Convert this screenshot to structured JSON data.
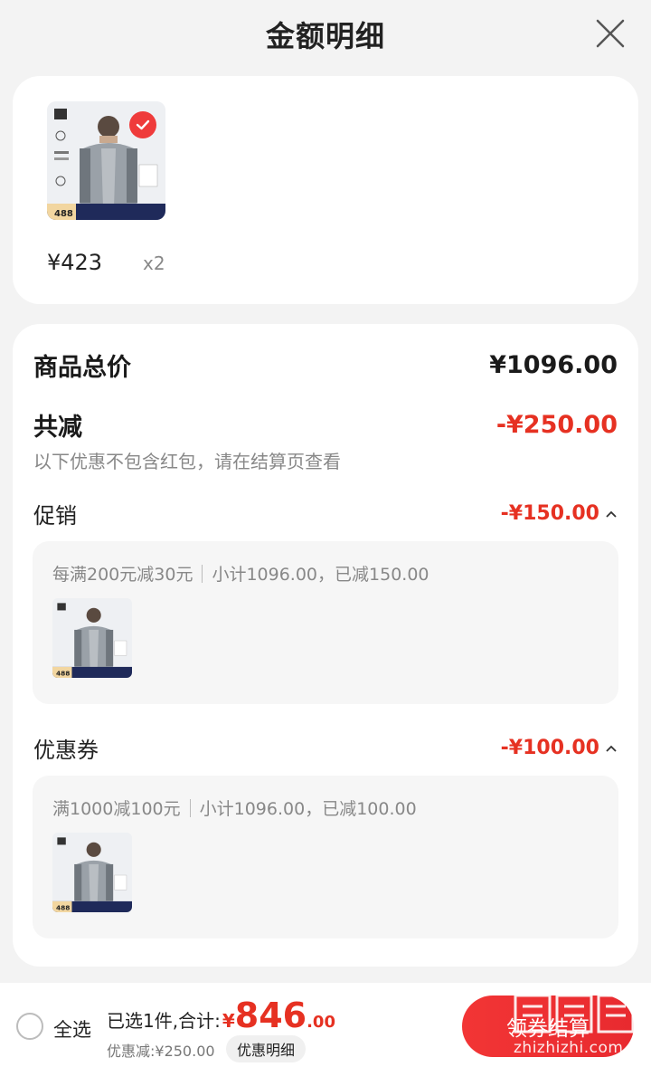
{
  "header": {
    "title": "金额明细"
  },
  "product": {
    "price": "¥423",
    "qty": "x2",
    "thumb_price": "488"
  },
  "summary": {
    "total_label": "商品总价",
    "total_value": "¥1096.00",
    "reduce_label": "共减",
    "reduce_value": "-¥250.00",
    "note": "以下优惠不包含红包，请在结算页查看"
  },
  "promotion": {
    "label": "促销",
    "value": "-¥150.00",
    "rule": "每满200元减30元",
    "subtotal": "小计1096.00，已减150.00"
  },
  "coupon": {
    "label": "优惠券",
    "value": "-¥100.00",
    "rule": "满1000减100元",
    "subtotal": "小计1096.00，已减100.00"
  },
  "bottom": {
    "select_all": "全选",
    "selected_label": "已选1件,合计:",
    "currency": "¥",
    "total_int": "846",
    "total_dec": ".00",
    "discount_text": "优惠减:¥250.00",
    "detail_button": "优惠明细",
    "checkout_button": "领券结算"
  },
  "watermark": {
    "text": "zhizhizhi.com"
  },
  "colors": {
    "accent": "#e63122",
    "card_bg": "#ffffff",
    "page_bg": "#f3f3f3"
  }
}
